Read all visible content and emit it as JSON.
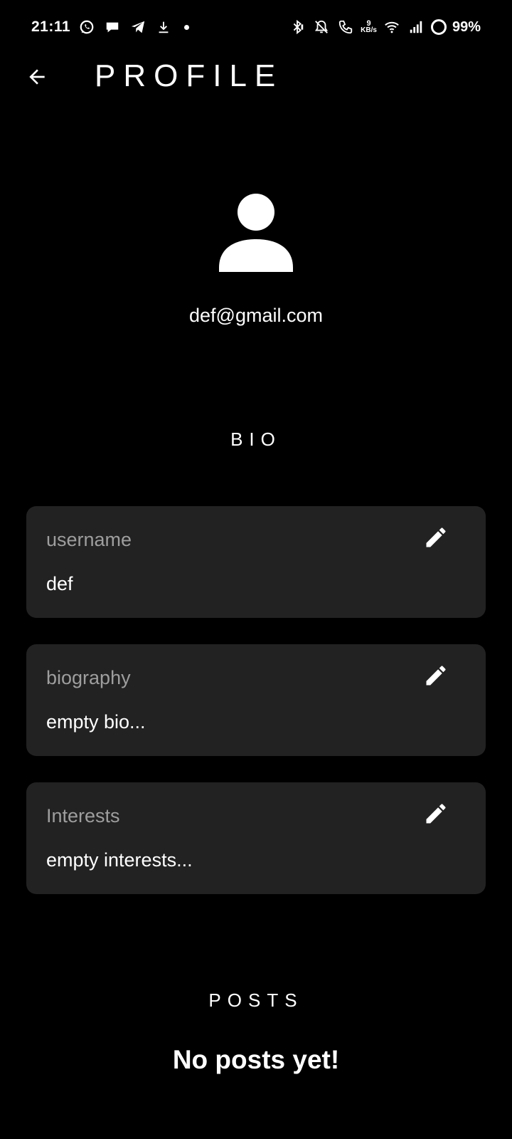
{
  "status_bar": {
    "time": "21:11",
    "left_icons": [
      "whatsapp-icon",
      "chat-bubble-icon",
      "telegram-icon",
      "download-icon",
      "dot-icon"
    ],
    "network_speed_value": "9",
    "network_speed_unit": "KB/s",
    "battery": "99%"
  },
  "app_bar": {
    "title": "PROFILE"
  },
  "profile": {
    "email": "def@gmail.com"
  },
  "bio_section": {
    "title": "BIO",
    "fields": [
      {
        "label": "username",
        "value": "def"
      },
      {
        "label": "biography",
        "value": "empty bio..."
      },
      {
        "label": "Interests",
        "value": "empty interests..."
      }
    ]
  },
  "posts_section": {
    "title": "POSTS",
    "empty_message": "No posts yet!"
  },
  "colors": {
    "background": "#000000",
    "card": "#222222",
    "label": "#9e9e9e",
    "text": "#ffffff"
  }
}
